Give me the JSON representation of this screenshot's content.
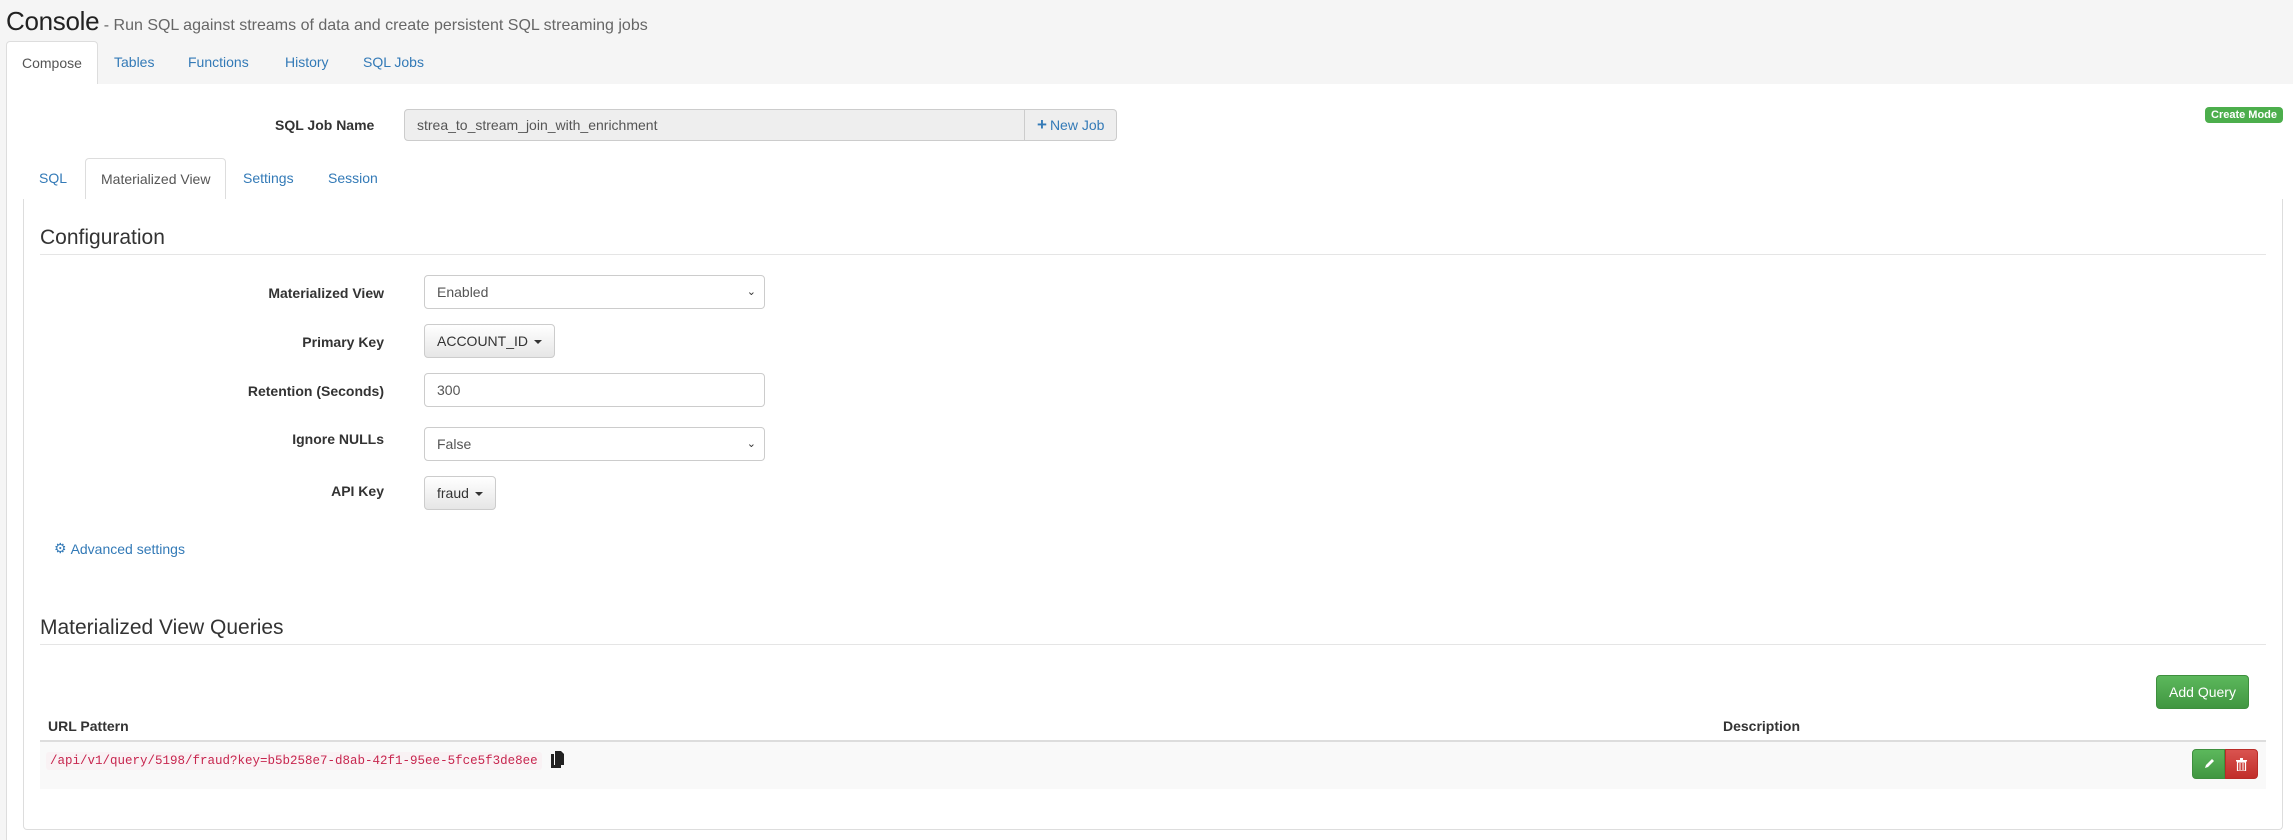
{
  "header": {
    "title": "Console",
    "subtitle": " - Run SQL against streams of data and create persistent SQL streaming jobs"
  },
  "top_tabs": [
    {
      "label": "Compose",
      "active": true
    },
    {
      "label": "Tables",
      "active": false
    },
    {
      "label": "Functions",
      "active": false
    },
    {
      "label": "History",
      "active": false
    },
    {
      "label": "SQL Jobs",
      "active": false
    }
  ],
  "job": {
    "label": "SQL Job Name",
    "value": "strea_to_stream_join_with_enrichment",
    "new_job_label": "New Job",
    "new_job_icon": "plus-icon"
  },
  "mode_badge": {
    "label": "Create Mode",
    "color": "#4cae4c"
  },
  "inner_tabs": [
    {
      "label": "SQL",
      "active": false
    },
    {
      "label": "Materialized View",
      "active": true
    },
    {
      "label": "Settings",
      "active": false
    },
    {
      "label": "Session",
      "active": false
    }
  ],
  "configuration": {
    "title": "Configuration",
    "fields": {
      "materialized_view": {
        "label": "Materialized View",
        "value": "Enabled"
      },
      "primary_key": {
        "label": "Primary Key",
        "value": "ACCOUNT_ID"
      },
      "retention": {
        "label": "Retention (Seconds)",
        "value": "300"
      },
      "ignore_nulls": {
        "label": "Ignore NULLs",
        "value": "False"
      },
      "api_key": {
        "label": "API Key",
        "value": "fraud"
      }
    },
    "advanced_settings_label": "Advanced settings",
    "advanced_settings_icon": "gears-icon"
  },
  "queries": {
    "title": "Materialized View Queries",
    "add_button_label": "Add Query",
    "columns": [
      "URL Pattern",
      "Description"
    ],
    "rows": [
      {
        "url_pattern": "/api/v1/query/5198/fraud?key=b5b258e7-d8ab-42f1-95ee-5fce5f3de8ee",
        "description": ""
      }
    ]
  },
  "colors": {
    "link": "#337ab7",
    "success": "#5cb85c",
    "danger": "#d9534f",
    "code": "#c7254e"
  }
}
